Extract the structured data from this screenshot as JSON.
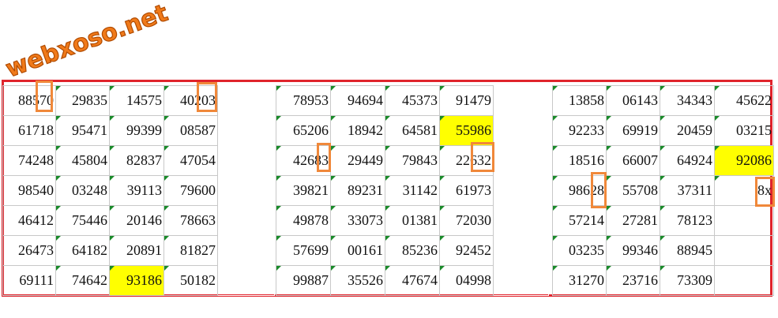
{
  "logo": {
    "text": "webxoso.net"
  },
  "tables": [
    {
      "rows": [
        [
          "88570",
          "29835",
          "14575",
          "40203",
          ""
        ],
        [
          "61718",
          "95471",
          "99399",
          "08587",
          ""
        ],
        [
          "74248",
          "45804",
          "82837",
          "47054",
          ""
        ],
        [
          "98540",
          "03248",
          "39113",
          "79600",
          ""
        ],
        [
          "46412",
          "75446",
          "20146",
          "78663",
          ""
        ],
        [
          "26473",
          "64182",
          "20891",
          "81827",
          ""
        ],
        [
          "69111",
          "74642",
          "93186",
          "50182",
          ""
        ]
      ]
    },
    {
      "rows": [
        [
          "78953",
          "94694",
          "45373",
          "91479",
          ""
        ],
        [
          "65206",
          "18942",
          "64581",
          "55986",
          ""
        ],
        [
          "42683",
          "29449",
          "79843",
          "22632",
          ""
        ],
        [
          "39821",
          "89231",
          "31142",
          "61973",
          ""
        ],
        [
          "49878",
          "33073",
          "01381",
          "72030",
          ""
        ],
        [
          "57699",
          "00161",
          "85236",
          "92452",
          ""
        ],
        [
          "99887",
          "35526",
          "47674",
          "04998",
          ""
        ]
      ]
    },
    {
      "rows": [
        [
          "13858",
          "06143",
          "34343",
          "45622"
        ],
        [
          "92233",
          "69919",
          "20459",
          "03215"
        ],
        [
          "18516",
          "66007",
          "64924",
          "92086"
        ],
        [
          "98628",
          "55708",
          "37311",
          "8x"
        ],
        [
          "57214",
          "27281",
          "78123",
          ""
        ],
        [
          "03235",
          "99346",
          "88945",
          ""
        ],
        [
          "31270",
          "23716",
          "73309",
          ""
        ]
      ]
    }
  ],
  "highlights": [
    {
      "table": 0,
      "row": 6,
      "col": 2
    },
    {
      "table": 1,
      "row": 1,
      "col": 3
    },
    {
      "table": 2,
      "row": 2,
      "col": 3
    }
  ],
  "colors": {
    "highlight": "#ffff00",
    "frame": "#e0242c",
    "box": "#f0883a",
    "logo": "#f07a1a"
  }
}
